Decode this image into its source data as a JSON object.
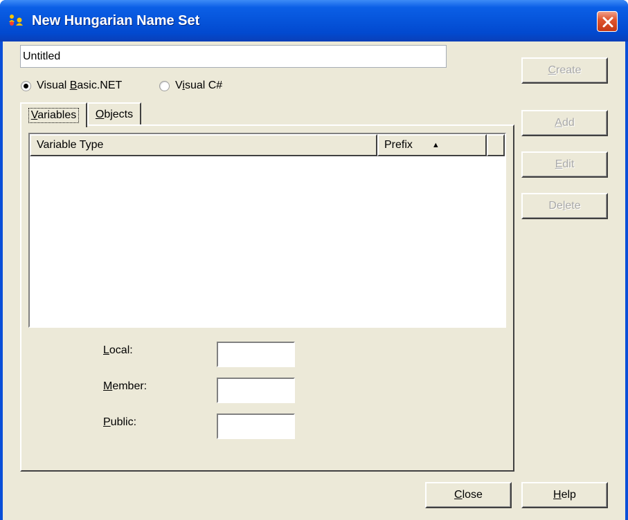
{
  "window": {
    "title": "New Hungarian Name Set",
    "icon": "hungarian-name-icon",
    "close_icon": "close-icon"
  },
  "name_field": {
    "value": "Untitled"
  },
  "language": {
    "options": [
      {
        "label_pre": "Visual ",
        "label_key": "B",
        "label_post": "asic.NET",
        "selected": true
      },
      {
        "label_pre": "V",
        "label_key": "i",
        "label_post": "sual C#",
        "selected": false
      }
    ]
  },
  "tabs": [
    {
      "label_key": "V",
      "label_post": "ariables",
      "active": true
    },
    {
      "label_key": "O",
      "label_post": "bjects",
      "active": false
    }
  ],
  "list": {
    "columns": [
      "Variable Type",
      "Prefix",
      ""
    ],
    "sort_column": "Prefix",
    "sort_direction": "ascending",
    "rows": []
  },
  "fields": [
    {
      "label_key": "L",
      "label_post": "ocal:",
      "value": ""
    },
    {
      "label_key": "M",
      "label_post": "ember:",
      "value": ""
    },
    {
      "label_key": "P",
      "label_post": "ublic:",
      "value": ""
    }
  ],
  "buttons": {
    "create": {
      "label_key": "C",
      "label_post": "reate",
      "enabled": false
    },
    "add": {
      "label_key": "A",
      "label_post": "dd",
      "enabled": false
    },
    "edit": {
      "label_key": "E",
      "label_post": "dit",
      "enabled": false
    },
    "delete": {
      "label_pre": "De",
      "label_key": "l",
      "label_post": "ete",
      "enabled": false
    },
    "close": {
      "label_key": "C",
      "label_post": "lose",
      "enabled": true
    },
    "help": {
      "label_key": "H",
      "label_post": "elp",
      "enabled": true
    }
  },
  "colors": {
    "titlebar": "#0654da",
    "face": "#ece9d8",
    "close_red": "#e0552f"
  }
}
